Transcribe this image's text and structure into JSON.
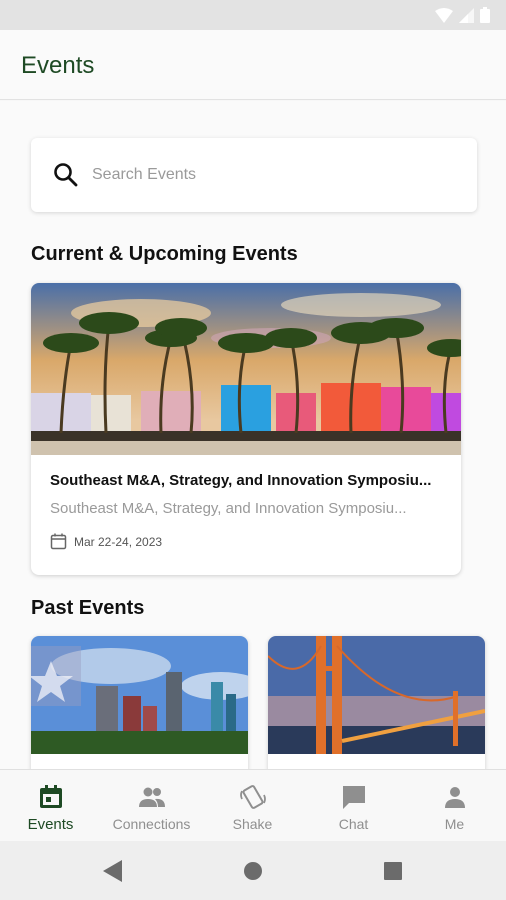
{
  "app": {
    "title": "Events"
  },
  "search": {
    "placeholder": "Search Events"
  },
  "sections": {
    "current": "Current & Upcoming Events",
    "past": "Past Events"
  },
  "current_events": [
    {
      "name": "Southeast M&A, Strategy, and Innovation Symposiu...",
      "subtitle": "Southeast M&A, Strategy, and Innovation Symposiu...",
      "date": "Mar 22-24, 2023",
      "image": "miami-palm-trees-image"
    }
  ],
  "past_events": [
    {
      "image": "houston-skyline-image"
    },
    {
      "image": "golden-gate-bridge-image"
    }
  ],
  "bottom_nav": [
    {
      "label": "Events",
      "icon": "calendar-icon",
      "active": true
    },
    {
      "label": "Connections",
      "icon": "people-icon",
      "active": false
    },
    {
      "label": "Shake",
      "icon": "shake-phone-icon",
      "active": false
    },
    {
      "label": "Chat",
      "icon": "chat-bubble-icon",
      "active": false
    },
    {
      "label": "Me",
      "icon": "person-icon",
      "active": false
    }
  ],
  "colors": {
    "brand": "#1e4a24",
    "inactive": "#8f8f8f"
  }
}
